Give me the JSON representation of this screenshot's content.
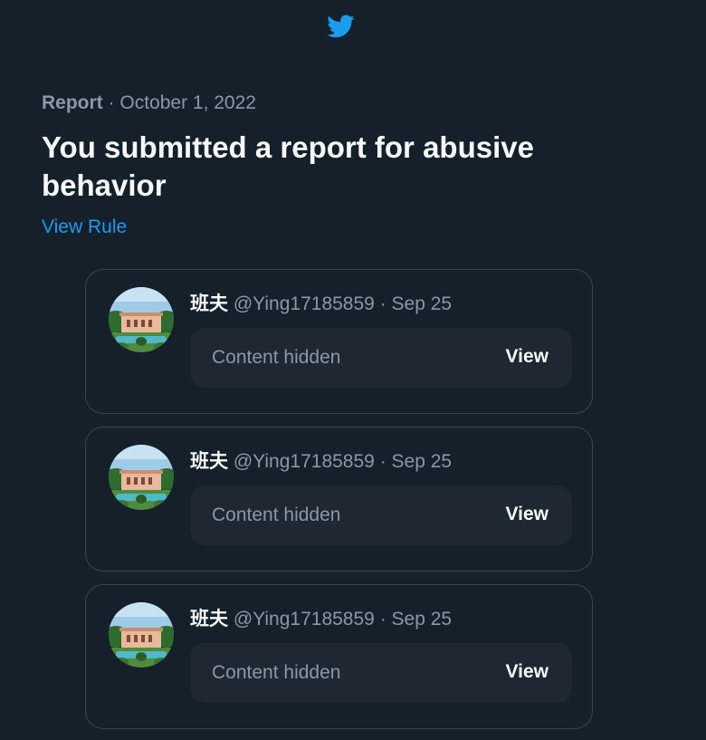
{
  "header": {
    "logo_icon": "twitter-bird-icon",
    "brand_color": "#1d9bf0"
  },
  "report": {
    "kind": "Report",
    "separator": "·",
    "date": "October 1, 2022",
    "title": "You submitted a report for abusive behavior",
    "view_rule_label": "View Rule"
  },
  "tweets": [
    {
      "name": "班夫",
      "handle": "@Ying17185859",
      "separator": "·",
      "date": "Sep 25",
      "hidden_text": "Content hidden",
      "view_label": "View"
    },
    {
      "name": "班夫",
      "handle": "@Ying17185859",
      "separator": "·",
      "date": "Sep 25",
      "hidden_text": "Content hidden",
      "view_label": "View"
    },
    {
      "name": "班夫",
      "handle": "@Ying17185859",
      "separator": "·",
      "date": "Sep 25",
      "hidden_text": "Content hidden",
      "view_label": "View"
    }
  ]
}
